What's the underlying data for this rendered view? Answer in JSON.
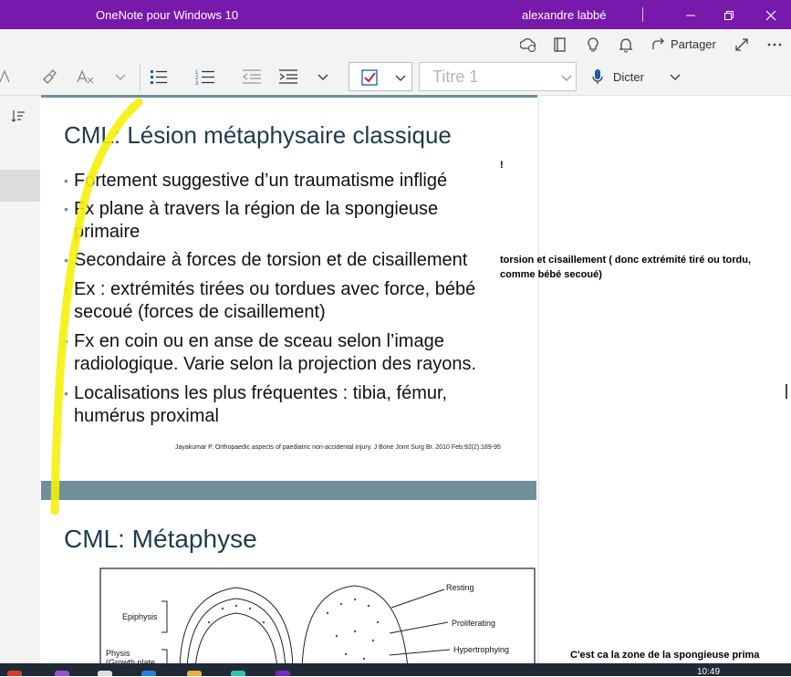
{
  "titlebar": {
    "app_title": "OneNote pour Windows 10",
    "user_name": "alexandre labbé",
    "minimize_icon": "minimize-icon",
    "restore_icon": "restore-icon",
    "close_icon": "close-icon"
  },
  "actionbar": {
    "icons": [
      "sync-status-icon",
      "page-notebook-icon",
      "lightbulb-icon",
      "bell-icon"
    ],
    "share_label": "Partager",
    "fullscreen_icon": "expand-icon",
    "more_icon": "more-icon"
  },
  "ribbon": {
    "style_placeholder": "Titre 1",
    "dictate_label": "Dicter",
    "accent": "#7719aa",
    "todo_check_color": "#c2262e"
  },
  "slide1": {
    "title": "CML: Lésion métaphysaire classique",
    "bullets": [
      "Fortement suggestive d’un traumatisme infligé",
      "Fx plane à travers la région de la spongieuse primaire",
      "Secondaire à forces de torsion et de cisaillement",
      "Ex : extrémités tirées ou tordues avec force, bébé secoué (forces de cisaillement)",
      "Fx en coin ou en anse de sceau selon l’image radiologique. Varie selon la projection des rayons.",
      "Localisations les plus fréquentes : tibia, fémur, humérus proximal"
    ],
    "citation": "Jayakumar P. Orthopaedic aspects of paediatric non-accidental injury. J Bone Joint Surg Br. 2010 Feb;92(2):189-95"
  },
  "slide2": {
    "title": "CML: Métaphyse",
    "diagram_labels": {
      "epiphysis": "Epiphysis",
      "physis_1": "Physis",
      "physis_2": "(Growth plate",
      "resting": "Resting",
      "proliferating": "Proliferating",
      "hypertrophying": "Hypertrophying"
    }
  },
  "notes": {
    "bang": "!",
    "torsion": "torsion et cisaillement ( donc extrémité tiré ou tordu, comme bébé secoué)",
    "zone": "C'est ca la zone de la spongieuse prima"
  },
  "taskbar": {
    "clock": "10:49"
  }
}
